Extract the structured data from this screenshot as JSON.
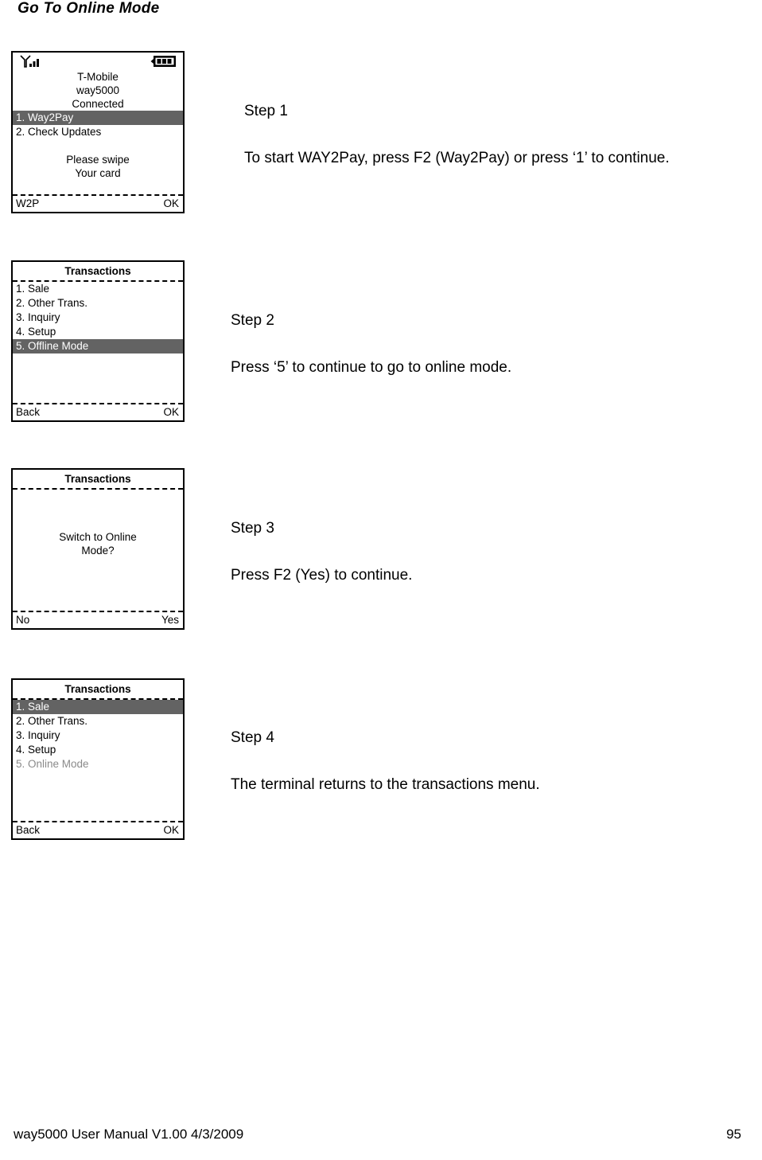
{
  "page": {
    "title": "Go To Online Mode",
    "footer_left": "way5000 User Manual V1.00     4/3/2009",
    "footer_page": "95"
  },
  "colors": {
    "highlight_bg": "#636363",
    "highlight_fg": "#ffffff",
    "disabled_fg": "#8a8a8a",
    "border": "#000000"
  },
  "screens": [
    {
      "id": "screen-1",
      "status_icons": {
        "signal": "signal-bars-icon",
        "battery": "battery-icon"
      },
      "center_lines": [
        "T-Mobile",
        "way5000",
        "Connected"
      ],
      "menu": [
        {
          "label": "1. Way2Pay",
          "state": "selected"
        },
        {
          "label": "2. Check Updates",
          "state": "normal"
        }
      ],
      "message_lines": [
        "Please swipe",
        "Your card"
      ],
      "softkeys": {
        "left": "W2P",
        "right": "OK"
      }
    },
    {
      "id": "screen-2",
      "title": "Transactions",
      "menu": [
        {
          "label": "1. Sale",
          "state": "normal"
        },
        {
          "label": "2. Other Trans.",
          "state": "normal"
        },
        {
          "label": "3. Inquiry",
          "state": "normal"
        },
        {
          "label": "4. Setup",
          "state": "normal"
        },
        {
          "label": "5. Offline Mode",
          "state": "selected"
        }
      ],
      "softkeys": {
        "left": "Back",
        "right": "OK"
      }
    },
    {
      "id": "screen-3",
      "title": "Transactions",
      "message_lines": [
        "Switch to Online",
        "Mode?"
      ],
      "softkeys": {
        "left": "No",
        "right": "Yes"
      }
    },
    {
      "id": "screen-4",
      "title": "Transactions",
      "menu": [
        {
          "label": "1. Sale",
          "state": "selected"
        },
        {
          "label": "2. Other Trans.",
          "state": "normal"
        },
        {
          "label": "3. Inquiry",
          "state": "normal"
        },
        {
          "label": "4. Setup",
          "state": "normal"
        },
        {
          "label": "5. Online Mode",
          "state": "disabled"
        }
      ],
      "softkeys": {
        "left": "Back",
        "right": "OK"
      }
    }
  ],
  "steps": [
    {
      "label": "Step 1",
      "text": "To start WAY2Pay, press F2 (Way2Pay) or press ‘1’ to continue."
    },
    {
      "label": "Step 2",
      "text": "Press ‘5’ to continue to go to online mode."
    },
    {
      "label": "Step 3",
      "text": "Press F2 (Yes) to continue."
    },
    {
      "label": "Step 4",
      "text": "The terminal returns to the transactions menu."
    }
  ]
}
